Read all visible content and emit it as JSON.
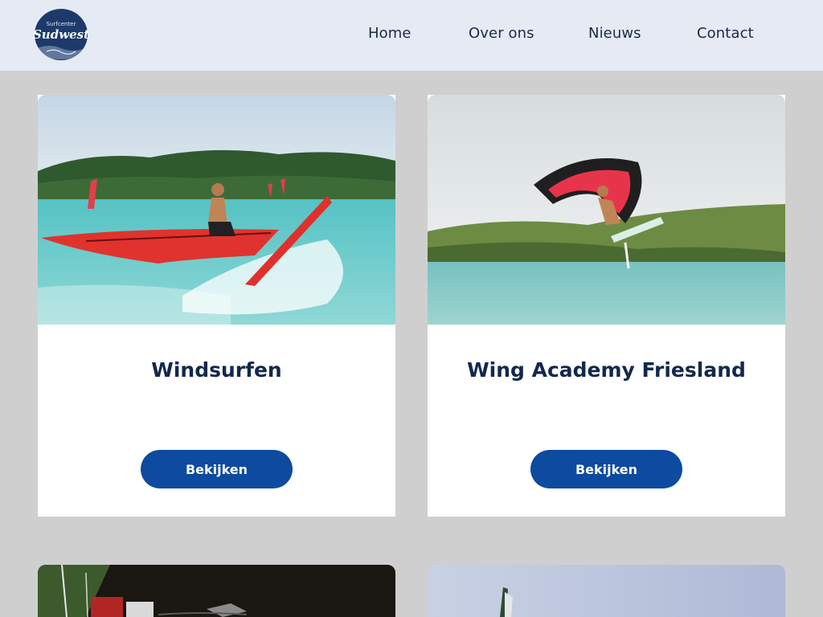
{
  "header": {
    "logo": {
      "line1": "Surfcenter",
      "line2": "Sudwest"
    },
    "nav": [
      {
        "label": "Home"
      },
      {
        "label": "Over ons"
      },
      {
        "label": "Nieuws"
      },
      {
        "label": "Contact"
      }
    ]
  },
  "cards": [
    {
      "title": "Windsurfen",
      "button_label": "Bekijken",
      "image": "windsurfer-jumping-photo"
    },
    {
      "title": "Wing Academy Friesland",
      "button_label": "Bekijken",
      "image": "wingfoiler-jumping-photo"
    },
    {
      "image": "aerial-shoreline-photo"
    },
    {
      "image": "sail-photo"
    }
  ],
  "colors": {
    "header_bg": "#e6eaf5",
    "page_bg": "#cfcfcf",
    "button": "#0c4ba0",
    "title": "#13284d"
  }
}
